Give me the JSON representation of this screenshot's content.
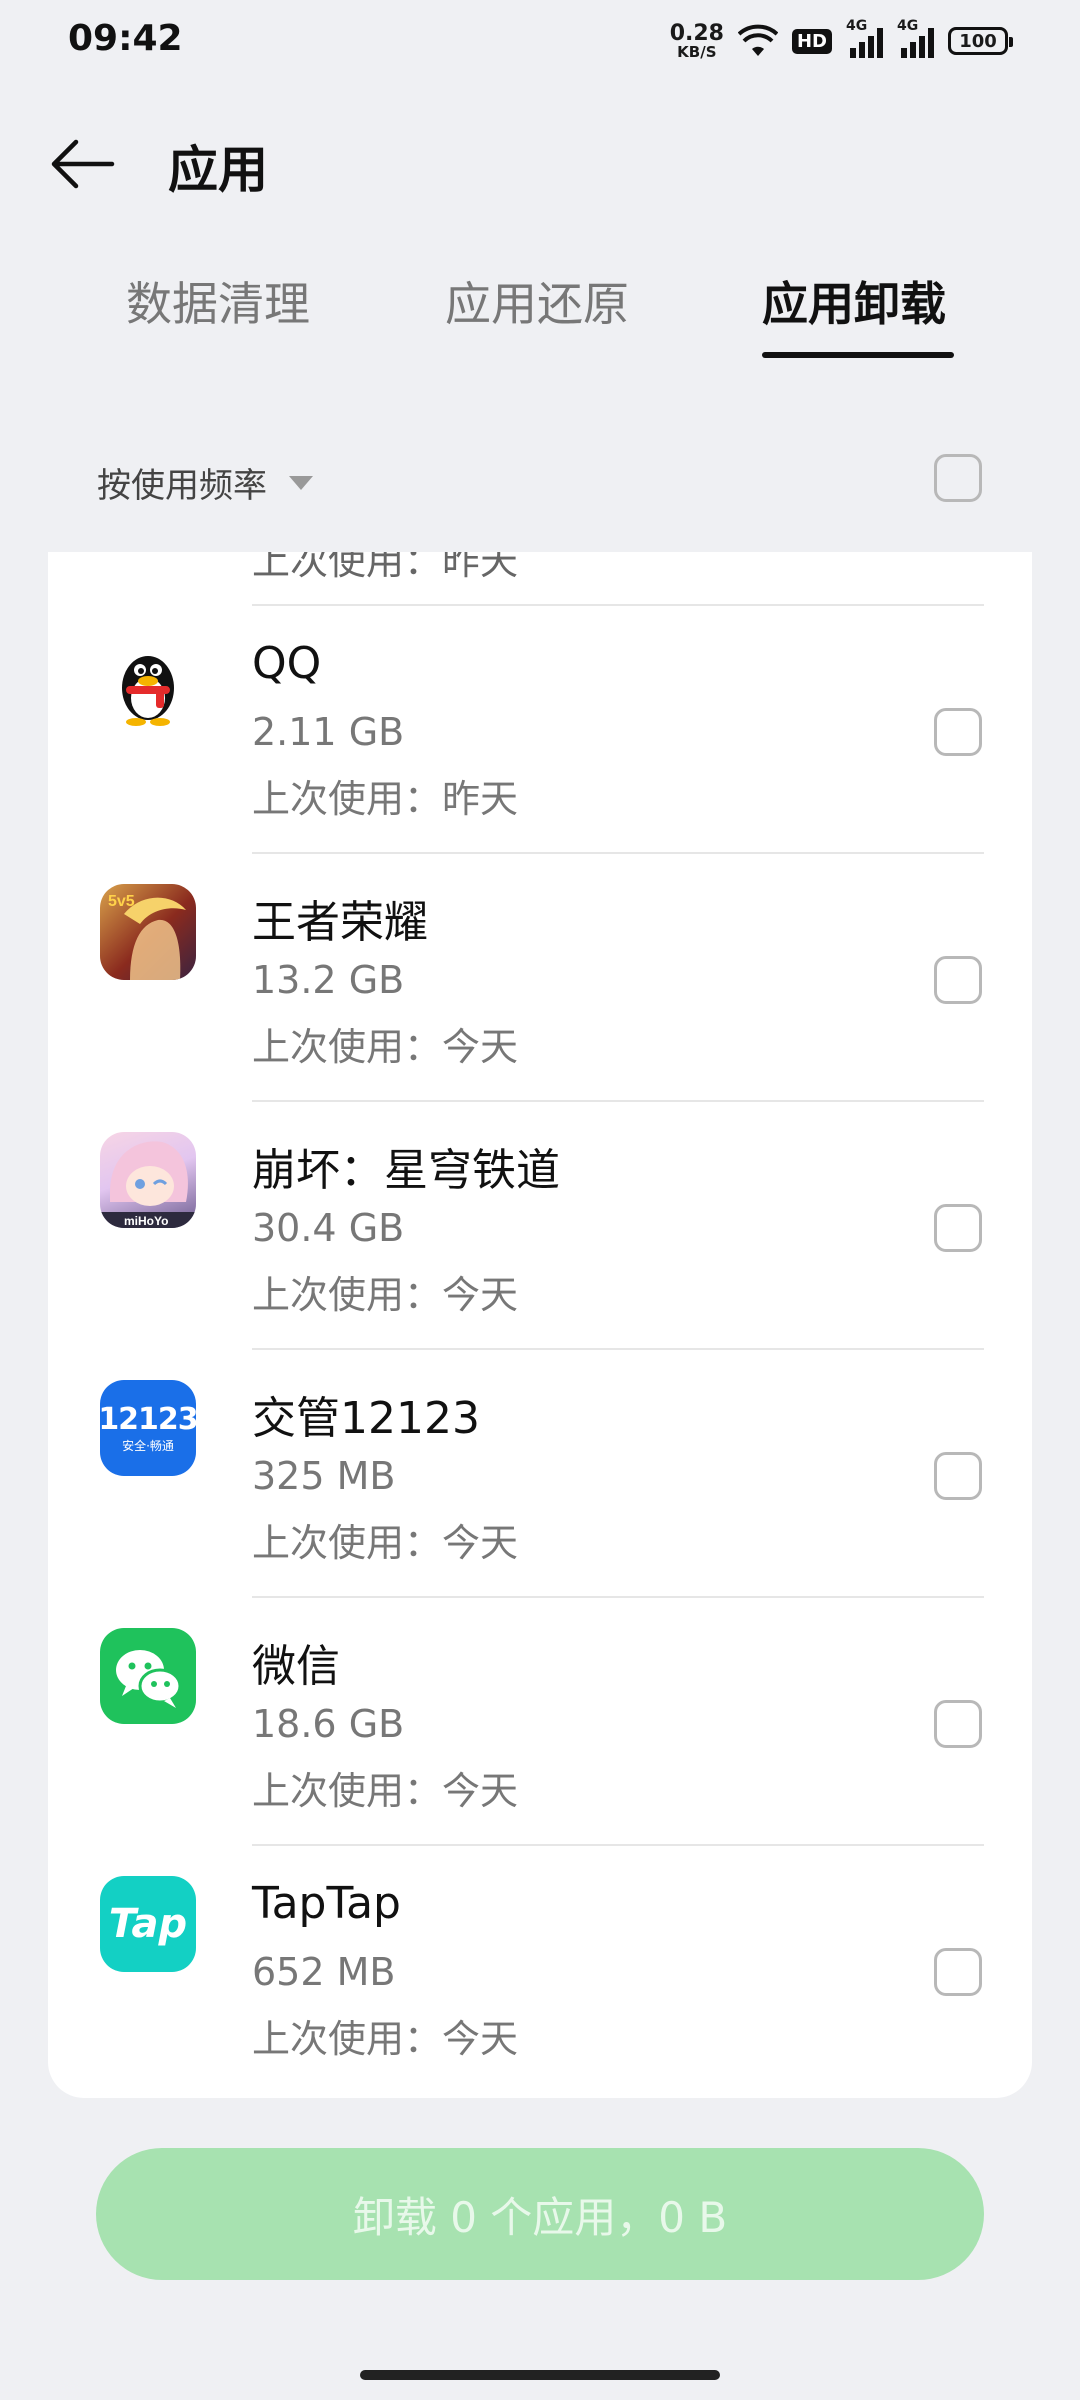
{
  "status": {
    "time": "09:42",
    "net_speed_value": "0.28",
    "net_speed_unit": "KB/S",
    "hd_label": "HD",
    "network_label_1": "4G",
    "network_label_2": "4G",
    "battery": "100"
  },
  "header": {
    "title": "应用",
    "back_icon": "arrow-left-icon"
  },
  "tabs": [
    {
      "label": "数据清理",
      "active": false
    },
    {
      "label": "应用还原",
      "active": false
    },
    {
      "label": "应用卸载",
      "active": true
    }
  ],
  "sort": {
    "label": "按使用频率"
  },
  "partial_item": {
    "last_used": "上次使用：昨天"
  },
  "apps": [
    {
      "name": "QQ",
      "size": "2.11 GB",
      "last_used": "上次使用：昨天",
      "icon": "qq-penguin-icon"
    },
    {
      "name": "王者荣耀",
      "size": "13.2 GB",
      "last_used": "上次使用：今天",
      "icon": "honor-of-kings-icon"
    },
    {
      "name": "崩坏：星穹铁道",
      "size": "30.4 GB",
      "last_used": "上次使用：今天",
      "icon": "honkai-star-rail-icon"
    },
    {
      "name": "交管12123",
      "size": "325 MB",
      "last_used": "上次使用：今天",
      "icon": "traffic-12123-icon",
      "icon_text": "12123",
      "icon_subtext": "安全·畅通"
    },
    {
      "name": "微信",
      "size": "18.6 GB",
      "last_used": "上次使用：今天",
      "icon": "wechat-icon"
    },
    {
      "name": "TapTap",
      "size": "652 MB",
      "last_used": "上次使用：今天",
      "icon": "taptap-icon",
      "icon_text": "Tap"
    }
  ],
  "uninstall_button": {
    "label": "卸载 0 个应用，0 B"
  }
}
